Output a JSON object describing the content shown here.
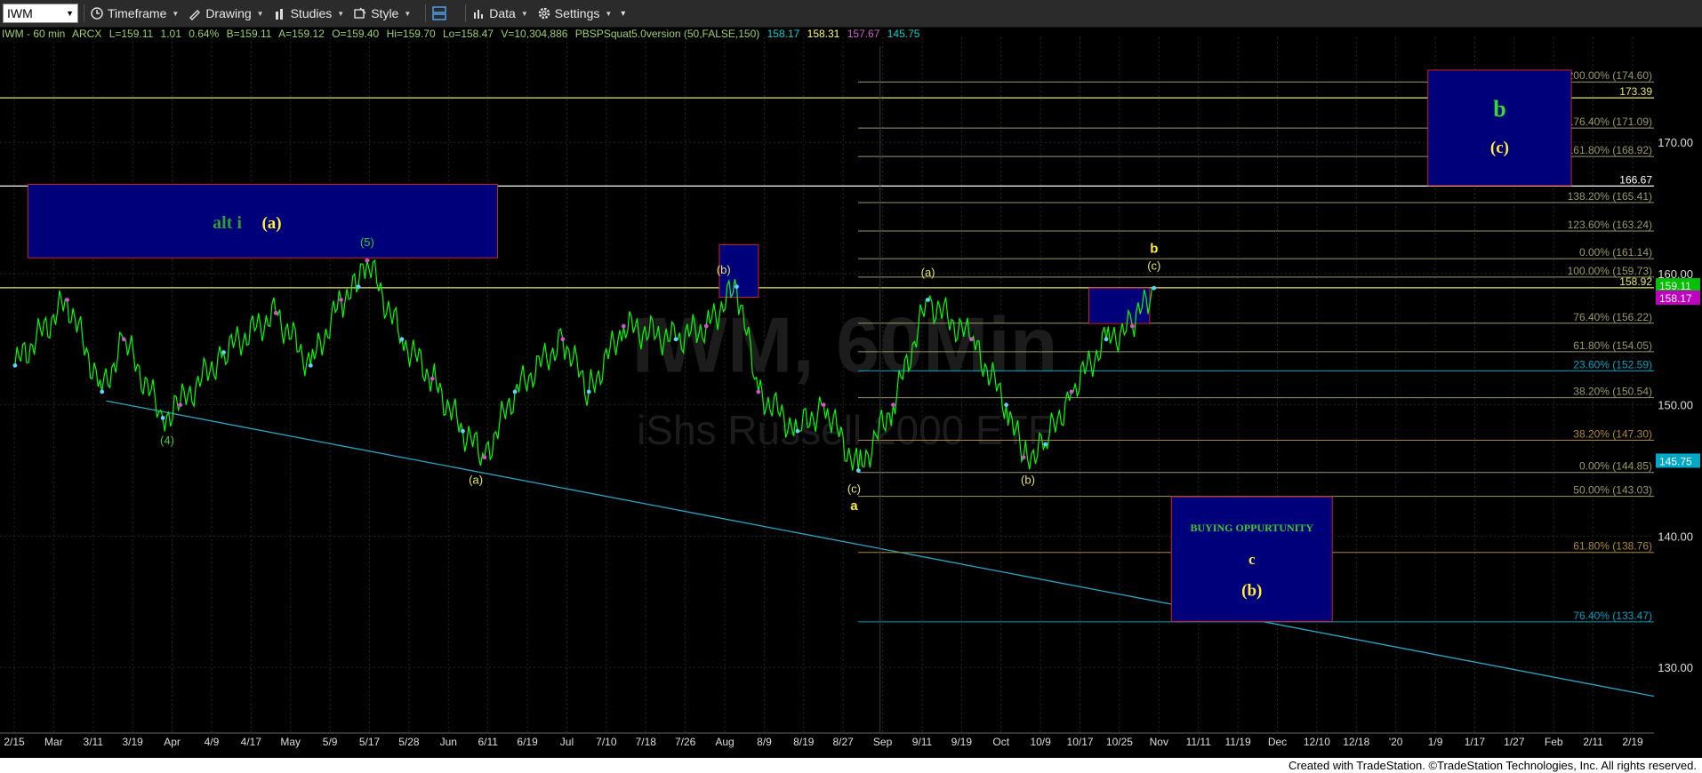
{
  "toolbar": {
    "symbol": "IWM",
    "timeframe": "Timeframe",
    "drawing": "Drawing",
    "studies": "Studies",
    "style": "Style",
    "data": "Data",
    "settings": "Settings"
  },
  "info": {
    "symbol": "IWM - 60 min",
    "exchange": "ARCX",
    "last": "L=159.11",
    "change": "1.01",
    "pct": "0.64%",
    "bid": "B=159.11",
    "ask": "A=159.12",
    "open": "O=159.40",
    "high": "Hi=159.70",
    "low": "Lo=158.47",
    "volume": "V=10,304,886",
    "study": "PBSPSquat5.0version (50,FALSE,150)",
    "study_values": [
      "158.17",
      "158.31",
      "157.67",
      "145.75"
    ]
  },
  "footer": "Created with TradeStation. ©TradeStation Technologies, Inc. All rights reserved.",
  "watermark": {
    "line1": "IWM, 60Min",
    "line2": "iShs Russell 2000 ETF"
  },
  "colors": {
    "price_up": "#00ff00",
    "axis": "#dddddd",
    "fib": "#aaaa66",
    "box": "#00007a",
    "box_border": "#cc2222",
    "trend": "#2aa6c7"
  },
  "chart_data": {
    "type": "line",
    "series": [
      {
        "name": "IWM",
        "values": [
          {
            "x": "2018-02-16",
            "y": 153
          },
          {
            "x": "2018-02-28",
            "y": 158
          },
          {
            "x": "2018-03-08",
            "y": 151
          },
          {
            "x": "2018-03-13",
            "y": 155
          },
          {
            "x": "2018-03-22",
            "y": 149
          },
          {
            "x": "2018-03-26",
            "y": 150
          },
          {
            "x": "2018-04-05",
            "y": 154
          },
          {
            "x": "2018-04-17",
            "y": 157
          },
          {
            "x": "2018-04-25",
            "y": 153
          },
          {
            "x": "2018-05-02",
            "y": 158
          },
          {
            "x": "2018-05-06",
            "y": 159
          },
          {
            "x": "2018-05-08",
            "y": 161
          },
          {
            "x": "2018-05-16",
            "y": 155
          },
          {
            "x": "2018-05-23",
            "y": 152
          },
          {
            "x": "2018-05-30",
            "y": 148
          },
          {
            "x": "2018-06-04",
            "y": 146
          },
          {
            "x": "2018-06-11",
            "y": 151
          },
          {
            "x": "2018-06-22",
            "y": 155
          },
          {
            "x": "2018-06-28",
            "y": 151
          },
          {
            "x": "2018-07-06",
            "y": 156
          },
          {
            "x": "2018-07-18",
            "y": 155
          },
          {
            "x": "2018-07-25",
            "y": 156
          },
          {
            "x": "2018-08-01",
            "y": 159
          },
          {
            "x": "2018-08-06",
            "y": 151
          },
          {
            "x": "2018-08-15",
            "y": 148
          },
          {
            "x": "2018-08-21",
            "y": 150
          },
          {
            "x": "2018-08-29",
            "y": 145
          },
          {
            "x": "2018-09-06",
            "y": 150
          },
          {
            "x": "2018-09-14",
            "y": 158
          },
          {
            "x": "2018-09-24",
            "y": 155
          },
          {
            "x": "2018-10-02",
            "y": 150
          },
          {
            "x": "2018-10-06",
            "y": 146
          },
          {
            "x": "2018-10-11",
            "y": 147
          },
          {
            "x": "2018-10-17",
            "y": 151
          },
          {
            "x": "2018-10-25",
            "y": 155
          },
          {
            "x": "2018-10-31",
            "y": 156
          },
          {
            "x": "2018-11-05",
            "y": 158.9
          }
        ]
      }
    ],
    "y_axis_labels": [
      130,
      140,
      150,
      160,
      170
    ],
    "ylim": [
      125,
      178
    ],
    "x_tick_labels": [
      "2/15",
      "Mar",
      "3/11",
      "3/19",
      "Apr",
      "4/9",
      "4/17",
      "May",
      "5/9",
      "5/17",
      "5/28",
      "Jun",
      "6/11",
      "6/19",
      "Jul",
      "7/10",
      "7/18",
      "7/26",
      "Aug",
      "8/9",
      "8/19",
      "8/27",
      "Sep",
      "9/11",
      "9/19",
      "Oct",
      "10/9",
      "10/17",
      "10/25",
      "Nov",
      "11/11",
      "11/19",
      "Dec",
      "12/10",
      "12/18",
      "'20",
      "1/9",
      "1/17",
      "1/27",
      "Feb",
      "2/11",
      "2/19"
    ],
    "price_tags": [
      {
        "value": 159.11,
        "label": "159.11",
        "color": "#00c000"
      },
      {
        "value": 158.17,
        "label": "158.17",
        "color": "#c000c0"
      },
      {
        "value": 145.75,
        "label": "145.75",
        "color": "#00a8c8"
      }
    ],
    "levels": [
      {
        "value": 174.6,
        "label": "200.00% (174.60)",
        "color": "#999966"
      },
      {
        "value": 173.39,
        "label": "173.39",
        "color": "#e8e860",
        "line": true
      },
      {
        "value": 171.09,
        "label": "176.40% (171.09)",
        "color": "#999966"
      },
      {
        "value": 168.92,
        "label": "161.80% (168.92)",
        "color": "#999966"
      },
      {
        "value": 166.67,
        "label": "166.67",
        "color": "#ffffff",
        "line": true
      },
      {
        "value": 165.41,
        "label": "138.20% (165.41)",
        "color": "#999966"
      },
      {
        "value": 163.24,
        "label": "123.60% (163.24)",
        "color": "#999966"
      },
      {
        "value": 161.14,
        "label": "0.00% (161.14)",
        "color": "#999966"
      },
      {
        "value": 159.73,
        "label": "100.00% (159.73)",
        "color": "#999966"
      },
      {
        "value": 158.92,
        "label": "158.92",
        "color": "#e8e860",
        "line": true
      },
      {
        "value": 156.22,
        "label": "76.40% (156.22)",
        "color": "#999966"
      },
      {
        "value": 154.05,
        "label": "61.80% (154.05)",
        "color": "#999966"
      },
      {
        "value": 152.59,
        "label": "23.60% (152.59)",
        "color": "#00a0c0"
      },
      {
        "value": 150.54,
        "label": "38.20% (150.54)",
        "color": "#999966"
      },
      {
        "value": 147.3,
        "label": "38.20% (147.30)",
        "color": "#aa8833"
      },
      {
        "value": 144.85,
        "label": "0.00% (144.85)",
        "color": "#999966"
      },
      {
        "value": 143.03,
        "label": "50.00% (143.03)",
        "color": "#999966"
      },
      {
        "value": 138.76,
        "label": "61.80% (138.76)",
        "color": "#aa8833"
      },
      {
        "value": 133.47,
        "label": "76.40% (133.47)",
        "color": "#00a0c0"
      }
    ],
    "boxes": [
      {
        "x1": "2018-02-19",
        "x2": "2018-06-07",
        "y1": 161.2,
        "y2": 166.8,
        "labels": [
          {
            "text": "alt i",
            "color": "#2fa02f",
            "size": 20
          },
          {
            "text": "(a)",
            "color": "#ffee33",
            "size": 19
          }
        ]
      },
      {
        "x1": "2018-07-28",
        "x2": "2018-08-06",
        "y1": 158.2,
        "y2": 162.2,
        "labels": []
      },
      {
        "x1": "2018-10-21",
        "x2": "2018-11-04",
        "y1": 156.2,
        "y2": 158.9,
        "labels": []
      },
      {
        "x1": "2018-11-09",
        "x2": "2018-12-16",
        "y1": 133.5,
        "y2": 143.0,
        "labels": [
          {
            "text": "BUYING OPPURTUNITY",
            "color": "#33cc33",
            "size": 12
          },
          {
            "text": "c",
            "color": "#ffee33",
            "size": 17
          },
          {
            "text": "(b)",
            "color": "#ffee33",
            "size": 19
          }
        ]
      },
      {
        "x1": "2019-01-07",
        "x2": "2019-02-09",
        "y1": 166.7,
        "y2": 175.5,
        "labels": [
          {
            "text": "b",
            "color": "#33dd33",
            "size": 26
          },
          {
            "text": "(c)",
            "color": "#ffee33",
            "size": 19
          }
        ]
      }
    ],
    "wave_labels": [
      {
        "x": "2018-05-08",
        "y": 162.1,
        "text": "(5)",
        "color": "#33cc33"
      },
      {
        "x": "2018-03-23",
        "y": 147.0,
        "text": "(4)",
        "color": "#33cc33"
      },
      {
        "x": "2018-06-02",
        "y": 144.0,
        "text": "(a)",
        "color": "#e8e860"
      },
      {
        "x": "2018-07-29",
        "y": 160.0,
        "text": "(b)",
        "color": "#e8e860"
      },
      {
        "x": "2018-08-28",
        "y": 143.3,
        "text": "(c)",
        "color": "#e8e860"
      },
      {
        "x": "2018-08-28",
        "y": 142.0,
        "text": "a",
        "color": "#ffee33"
      },
      {
        "x": "2018-09-14",
        "y": 159.8,
        "text": "(a)",
        "color": "#e8e860"
      },
      {
        "x": "2018-10-07",
        "y": 144.0,
        "text": "(b)",
        "color": "#e8e860"
      },
      {
        "x": "2018-11-05",
        "y": 161.6,
        "text": "b",
        "color": "#ffee33"
      },
      {
        "x": "2018-11-05",
        "y": 160.3,
        "text": "(c)",
        "color": "#e8e860"
      }
    ]
  }
}
